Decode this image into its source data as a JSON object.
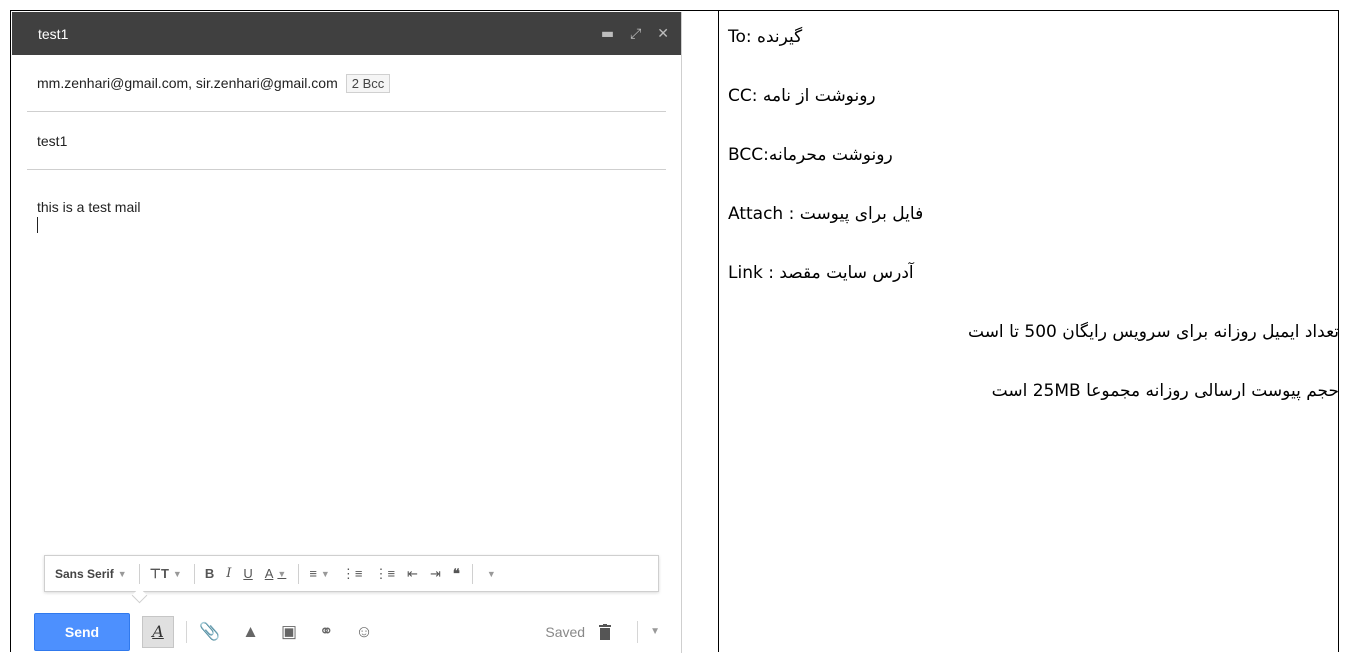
{
  "compose": {
    "title": "test1",
    "recipients": "mm.zenhari@gmail.com, sir.zenhari@gmail.com",
    "bcc_badge": "2 Bcc",
    "subject": "test1",
    "body": "this is a test mail"
  },
  "format_bar": {
    "font": "Sans Serif",
    "bold": "B",
    "italic": "I",
    "underline": "U",
    "text_color": "A"
  },
  "bottom_bar": {
    "send": "Send",
    "format_toggle": "A",
    "saved": "Saved"
  },
  "notes": [
    "To: گیرنده",
    "CC: رونوشت از نامه",
    "BCC:رونوشت محرمانه",
    "Attach : فایل برای پیوست",
    "Link : آدرس سایت مقصد",
    "تعداد ایمیل روزانه برای سرویس رایگان 500 تا است",
    "حجم پیوست ارسالی روزانه مجموعا 25MB است"
  ],
  "colors": {
    "titlebar": "#404040",
    "send_button": "#4d90fe"
  }
}
